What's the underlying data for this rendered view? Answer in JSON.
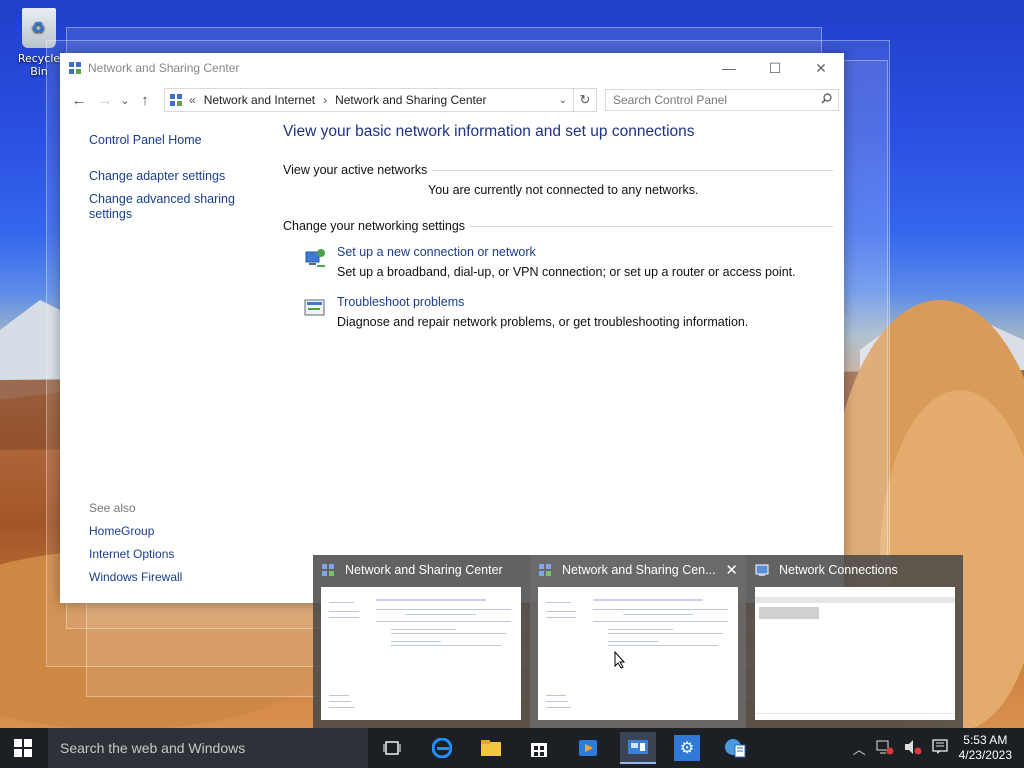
{
  "desktop": {
    "recycle_bin_label": "Recycle Bin"
  },
  "window": {
    "title": "Network and Sharing Center",
    "controls": {
      "minimize": "—",
      "maximize": "☐",
      "close": "✕"
    },
    "nav": {
      "back": "←",
      "forward": "→",
      "recent": "⌄",
      "up": "↑"
    },
    "address": {
      "overflow": "«",
      "crumb1": "Network and Internet",
      "separator": "›",
      "crumb2": "Network and Sharing Center",
      "dropdown": "⌄",
      "refresh": "↻"
    },
    "search": {
      "placeholder": "Search Control Panel"
    },
    "sidebar": {
      "home": "Control Panel Home",
      "adapter": "Change adapter settings",
      "advanced": "Change advanced sharing settings",
      "see_also": "See also",
      "homegroup": "HomeGroup",
      "internet_options": "Internet Options",
      "firewall": "Windows Firewall"
    },
    "main": {
      "heading": "View your basic network information and set up connections",
      "active_networks": "View your active networks",
      "not_connected": "You are currently not connected to any networks.",
      "change_settings": "Change your networking settings",
      "task1_link": "Set up a new connection or network",
      "task1_desc": "Set up a broadband, dial-up, or VPN connection; or set up a router or access point.",
      "task2_link": "Troubleshoot problems",
      "task2_desc": "Diagnose and repair network problems, or get troubleshooting information."
    }
  },
  "thumbnails": {
    "t1_title": "Network and Sharing Center",
    "t2_title": "Network and Sharing Cen...",
    "t3_title": "Network Connections",
    "close": "✕"
  },
  "taskbar": {
    "search_placeholder": "Search the web and Windows",
    "time": "5:53 AM",
    "date": "4/23/2023"
  },
  "colors": {
    "link": "#1a3e8c",
    "heading": "#1e3287",
    "taskbar": "#1c1f24"
  }
}
